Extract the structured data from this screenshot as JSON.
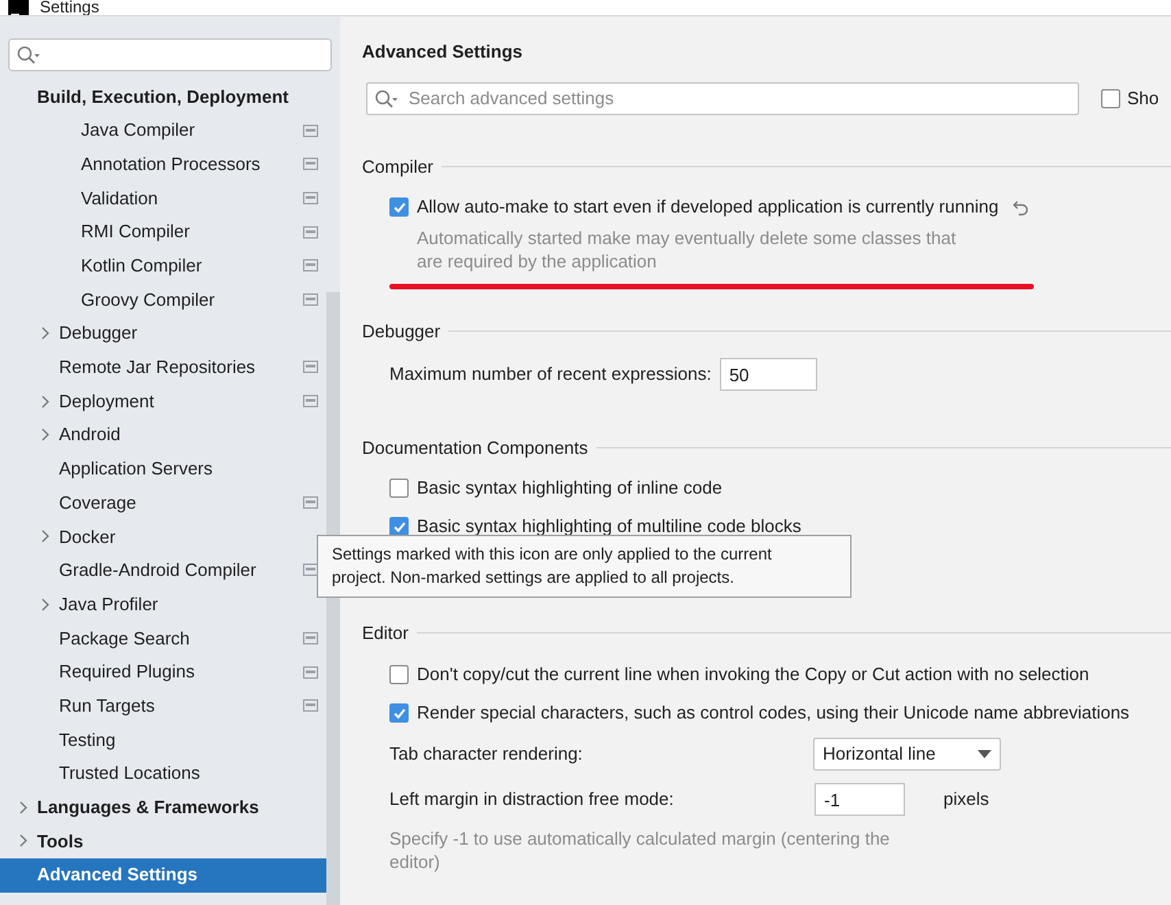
{
  "window": {
    "title": "Settings"
  },
  "sidebar": {
    "items": [
      {
        "label": "Build, Execution, Deployment",
        "expanded": true,
        "selected": false,
        "project_scoped": false,
        "children": [
          {
            "children": [
              {
                "label": "Java Compiler",
                "selected": false,
                "project_scoped": true
              },
              {
                "label": "Annotation Processors",
                "selected": false,
                "project_scoped": true
              },
              {
                "label": "Validation",
                "selected": false,
                "project_scoped": true
              },
              {
                "label": "RMI Compiler",
                "selected": false,
                "project_scoped": true
              },
              {
                "label": "Kotlin Compiler",
                "selected": false,
                "project_scoped": true
              },
              {
                "label": "Groovy Compiler",
                "selected": false,
                "project_scoped": true
              }
            ]
          },
          {
            "label": "Debugger",
            "expanded": false,
            "selected": false,
            "project_scoped": false
          },
          {
            "label": "Remote Jar Repositories",
            "selected": false,
            "project_scoped": true
          },
          {
            "label": "Deployment",
            "expanded": false,
            "selected": false,
            "project_scoped": true
          },
          {
            "label": "Android",
            "expanded": false,
            "selected": false,
            "project_scoped": false
          },
          {
            "label": "Application Servers",
            "selected": false,
            "project_scoped": false
          },
          {
            "label": "Coverage",
            "selected": false,
            "project_scoped": true
          },
          {
            "label": "Docker",
            "expanded": false,
            "selected": false,
            "project_scoped": false
          },
          {
            "label": "Gradle-Android Compiler",
            "selected": false,
            "project_scoped": true
          },
          {
            "label": "Java Profiler",
            "expanded": false,
            "selected": false,
            "project_scoped": false
          },
          {
            "label": "Package Search",
            "selected": false,
            "project_scoped": true
          },
          {
            "label": "Required Plugins",
            "selected": false,
            "project_scoped": true
          },
          {
            "label": "Run Targets",
            "selected": false,
            "project_scoped": true
          },
          {
            "label": "Testing",
            "selected": false,
            "project_scoped": false
          },
          {
            "label": "Trusted Locations",
            "selected": false,
            "project_scoped": false
          }
        ]
      },
      {
        "label": "Languages & Frameworks",
        "expanded": false,
        "selected": false,
        "project_scoped": false
      },
      {
        "label": "Tools",
        "expanded": false,
        "selected": false,
        "project_scoped": false
      },
      {
        "label": "Advanced Settings",
        "selected": true,
        "project_scoped": false
      }
    ]
  },
  "content": {
    "title": "Advanced Settings",
    "search": {
      "placeholder": "Search advanced settings"
    },
    "show_modified": {
      "label": "Sho",
      "checked": false
    },
    "sections": [
      {
        "title": "Compiler",
        "items": [
          {
            "kind": "checkbox",
            "label": "Allow auto-make to start even if developed application is currently running",
            "checked": true,
            "reset": true,
            "marked": true,
            "description": [
              "Automatically started make may eventually delete some classes that",
              "are required by the application"
            ]
          }
        ]
      },
      {
        "title": "Debugger",
        "items": [
          {
            "kind": "number",
            "label": "Maximum number of recent expressions:",
            "value": "50"
          }
        ]
      },
      {
        "title": "Documentation Components",
        "items": [
          {
            "kind": "checkbox",
            "label": "Basic syntax highlighting of inline code",
            "checked": false
          },
          {
            "kind": "checkbox",
            "label": "Basic syntax highlighting of multiline code blocks",
            "checked": true
          }
        ]
      },
      {
        "title": "Editor",
        "items": [
          {
            "kind": "checkbox",
            "label": "Don't copy/cut the current line when invoking the Copy or Cut action with no selection",
            "checked": false
          },
          {
            "kind": "checkbox",
            "label": "Render special characters, such as control codes, using their Unicode name abbreviations",
            "checked": true
          },
          {
            "kind": "dropdown",
            "label": "Tab character rendering:",
            "value": "Horizontal line"
          },
          {
            "kind": "number",
            "label": "Left margin in distraction free mode:",
            "value": "-1",
            "unit": "pixels",
            "description": [
              "Specify -1 to use automatically calculated margin (centering the",
              "editor)"
            ]
          }
        ]
      }
    ]
  },
  "tooltip": {
    "lines": [
      "Settings marked with this icon are only applied to the current",
      "project. Non-marked settings are applied to all projects."
    ]
  }
}
